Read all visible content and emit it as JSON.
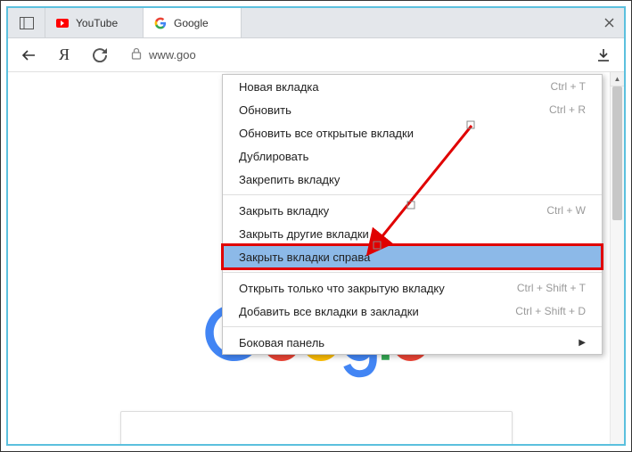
{
  "tabs": {
    "youtube": {
      "label": "YouTube"
    },
    "google": {
      "label": "Google"
    }
  },
  "omnibox": {
    "url": "www.goo"
  },
  "logo_colors": {
    "G": "#4285F4",
    "o1": "#EA4335",
    "o2": "#FBBC05",
    "g": "#4285F4",
    "l": "#34A853",
    "e": "#EA4335"
  },
  "menu": {
    "new_tab": "Новая вкладка",
    "new_tab_key": "Ctrl + T",
    "reload": "Обновить",
    "reload_key": "Ctrl + R",
    "reload_all": "Обновить все открытые вкладки",
    "duplicate": "Дублировать",
    "pin": "Закрепить вкладку",
    "close_tab": "Закрыть вкладку",
    "close_tab_key": "Ctrl + W",
    "close_others": "Закрыть другие вкладки",
    "close_right": "Закрыть вкладки справа",
    "reopen": "Открыть только что закрытую вкладку",
    "reopen_key": "Ctrl + Shift + T",
    "bookmark_all": "Добавить все вкладки в закладки",
    "bookmark_all_key": "Ctrl + Shift + D",
    "sidepanel": "Боковая панель"
  }
}
